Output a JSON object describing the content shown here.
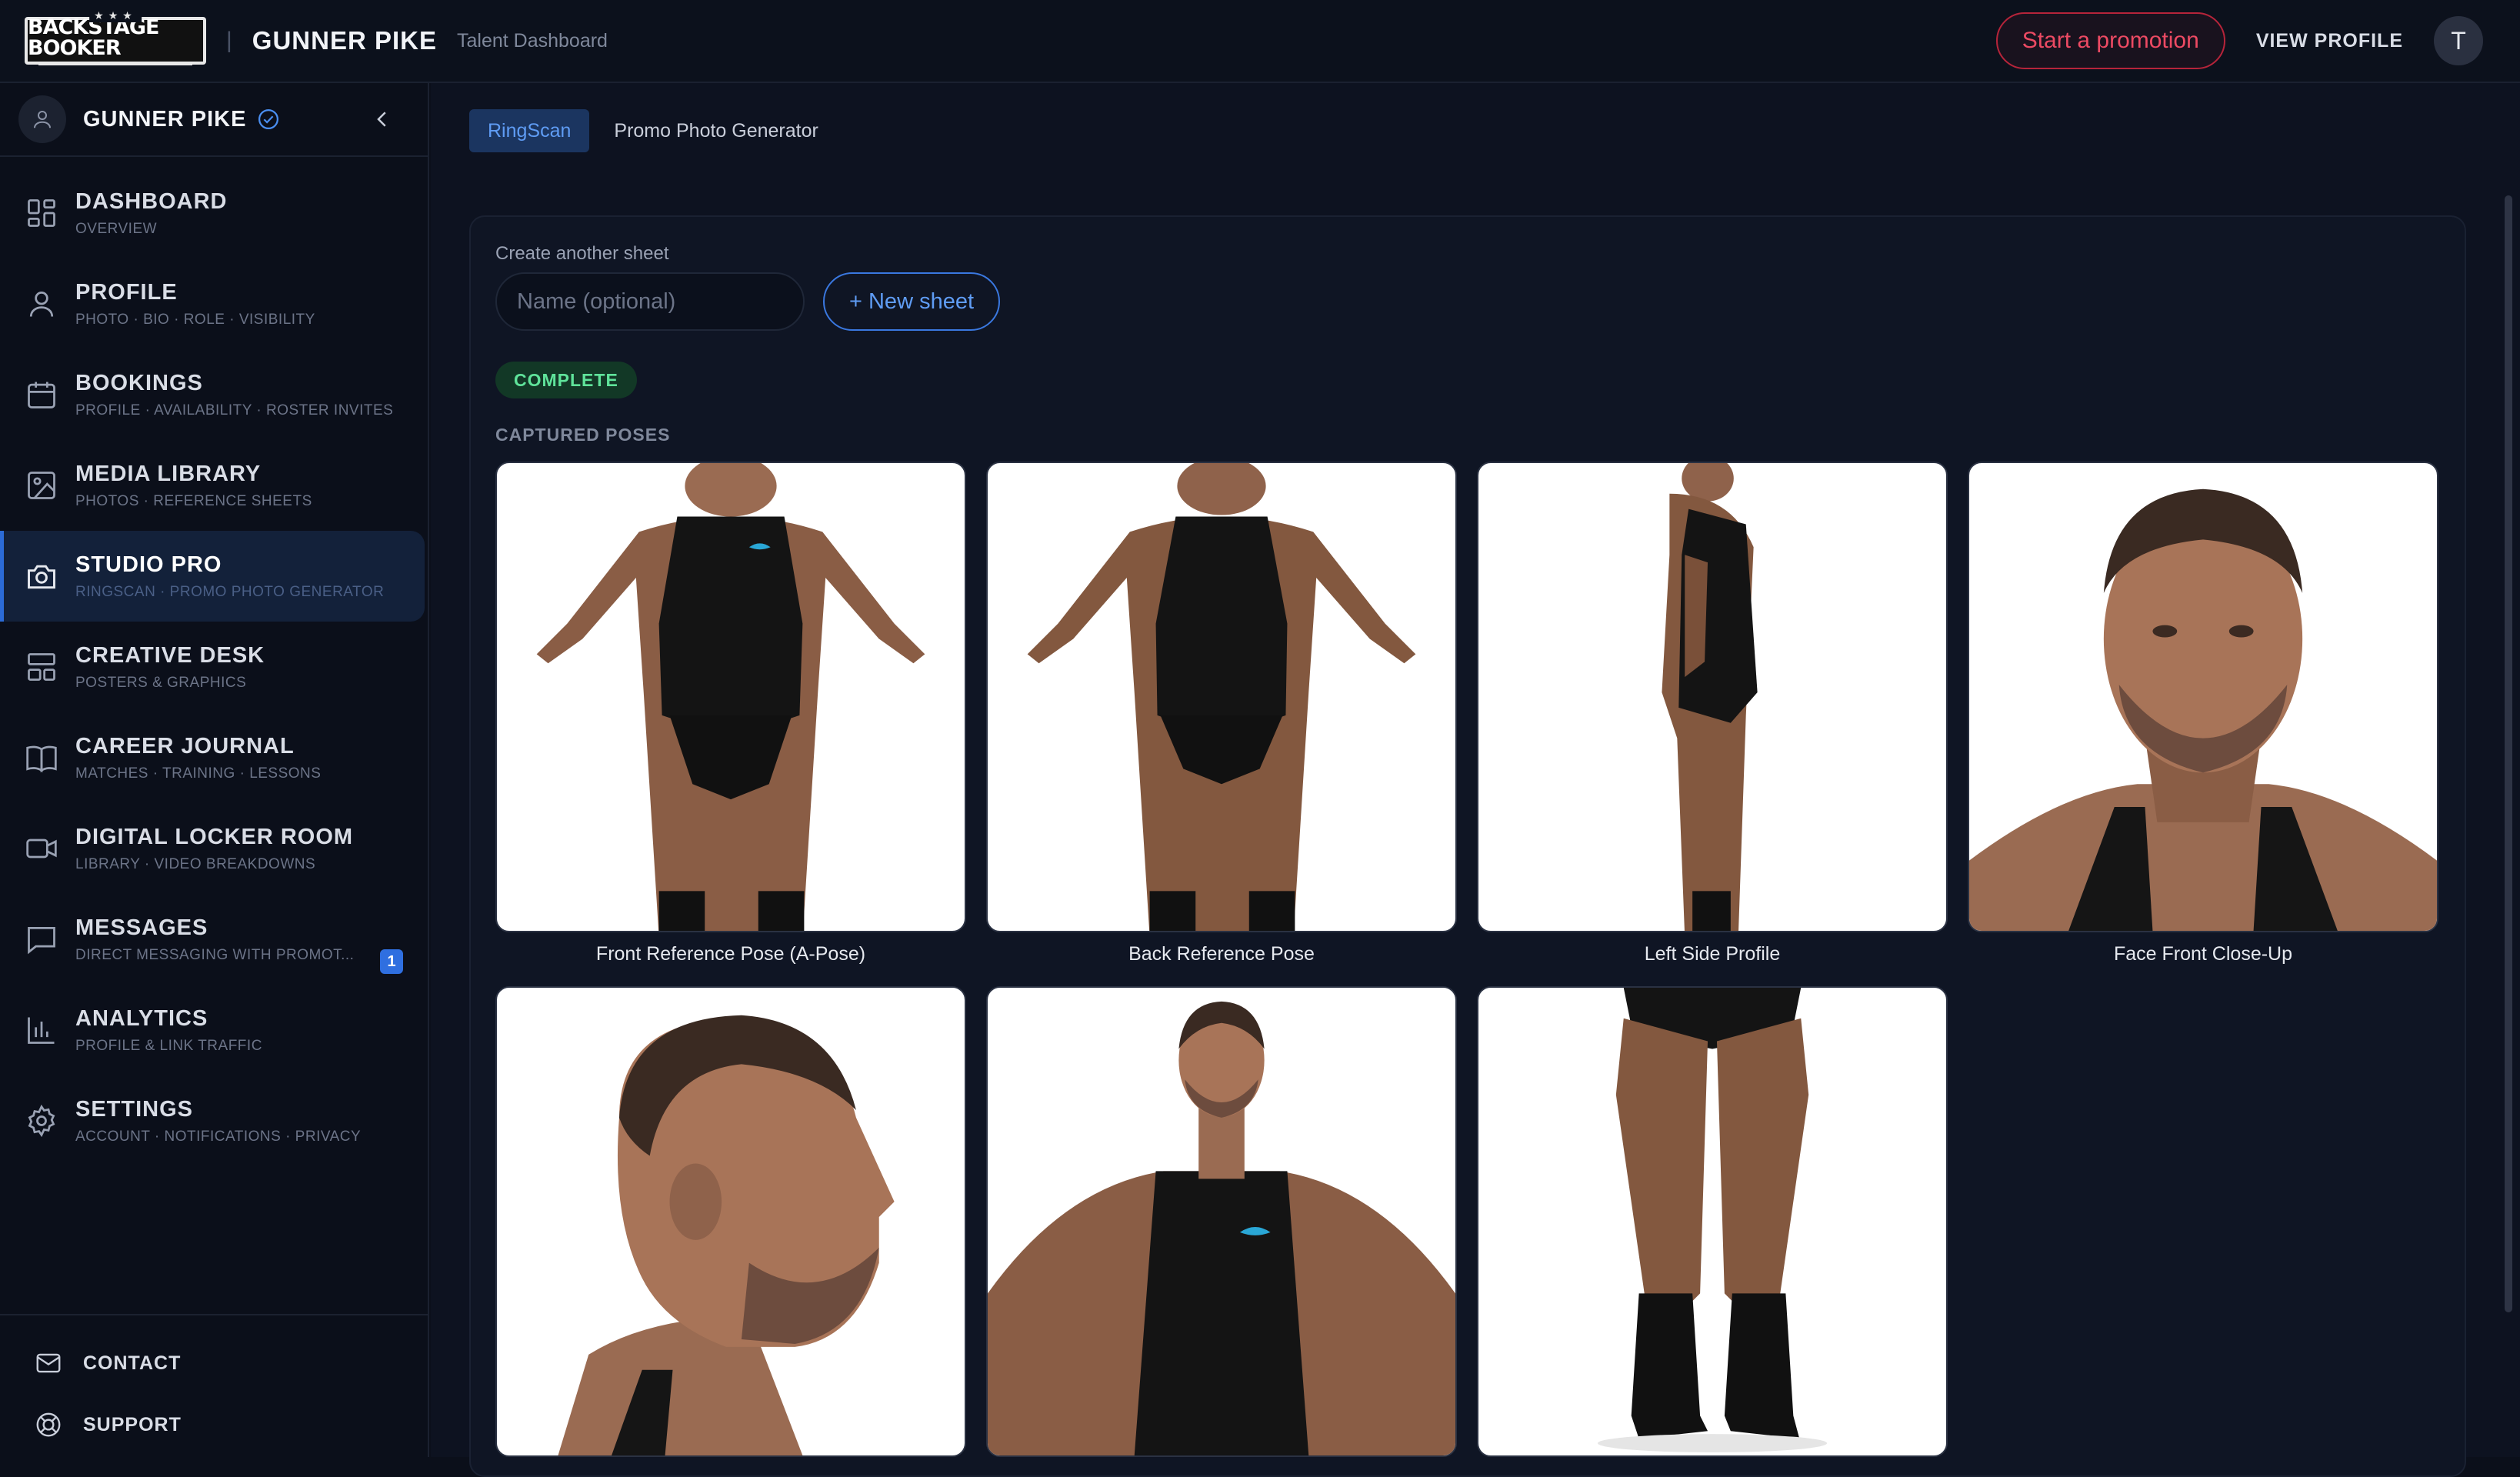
{
  "topbar": {
    "logo_text": "BACKSTAGE BOOKER",
    "talent_name": "GUNNER PIKE",
    "subtitle": "Talent Dashboard",
    "promo_button": "Start a promotion",
    "view_profile": "VIEW PROFILE",
    "avatar_initial": "T"
  },
  "sidebar": {
    "user_name": "GUNNER PIKE",
    "items": [
      {
        "title": "DASHBOARD",
        "sub": "OVERVIEW",
        "icon": "dashboard-icon"
      },
      {
        "title": "PROFILE",
        "sub": "PHOTO · BIO · ROLE · VISIBILITY",
        "icon": "user-icon"
      },
      {
        "title": "BOOKINGS",
        "sub": "PROFILE · AVAILABILITY · ROSTER INVITES",
        "icon": "calendar-icon"
      },
      {
        "title": "MEDIA LIBRARY",
        "sub": "PHOTOS · REFERENCE SHEETS",
        "icon": "image-icon"
      },
      {
        "title": "STUDIO PRO",
        "sub": "RINGSCAN · PROMO PHOTO GENERATOR",
        "icon": "camera-icon",
        "active": true
      },
      {
        "title": "CREATIVE DESK",
        "sub": "POSTERS & GRAPHICS",
        "icon": "layout-icon"
      },
      {
        "title": "CAREER JOURNAL",
        "sub": "MATCHES · TRAINING · LESSONS",
        "icon": "book-icon"
      },
      {
        "title": "DIGITAL LOCKER ROOM",
        "sub": "LIBRARY · VIDEO BREAKDOWNS",
        "icon": "video-icon"
      },
      {
        "title": "MESSAGES",
        "sub": "DIRECT MESSAGING WITH PROMOT...",
        "icon": "message-icon",
        "badge": "1"
      },
      {
        "title": "ANALYTICS",
        "sub": "PROFILE & LINK TRAFFIC",
        "icon": "chart-icon"
      },
      {
        "title": "SETTINGS",
        "sub": "ACCOUNT · NOTIFICATIONS · PRIVACY",
        "icon": "gear-icon"
      }
    ],
    "bottom": [
      {
        "label": "CONTACT",
        "icon": "mail-icon"
      },
      {
        "label": "SUPPORT",
        "icon": "lifebuoy-icon"
      }
    ]
  },
  "main": {
    "tabs": [
      {
        "label": "RingScan",
        "active": true
      },
      {
        "label": "Promo Photo Generator",
        "active": false
      }
    ],
    "create_label": "Create another sheet",
    "name_placeholder": "Name (optional)",
    "new_sheet_button": "+ New sheet",
    "status": "COMPLETE",
    "section_label": "CAPTURED POSES",
    "poses": [
      {
        "caption": "Front Reference Pose (A-Pose)"
      },
      {
        "caption": "Back Reference Pose"
      },
      {
        "caption": "Left Side Profile"
      },
      {
        "caption": "Face Front Close-Up"
      },
      {
        "caption": ""
      },
      {
        "caption": ""
      },
      {
        "caption": ""
      }
    ]
  },
  "colors": {
    "accent": "#2c6bd6",
    "promo": "#ec4a63",
    "status": "#5fe39a",
    "background": "#0b0f1a"
  }
}
